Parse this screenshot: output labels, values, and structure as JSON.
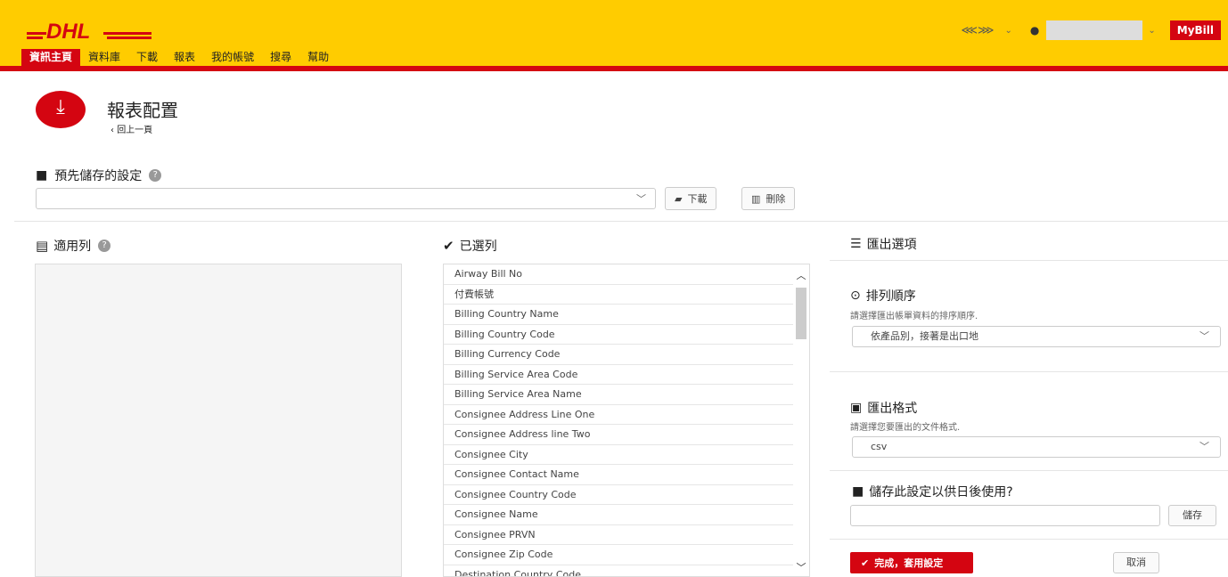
{
  "header": {
    "logo_text": "DHL",
    "mybill_label": "MyBill",
    "nav": [
      {
        "label": "資訊主頁",
        "active": true
      },
      {
        "label": "資料庫",
        "active": false
      },
      {
        "label": "下載",
        "active": false
      },
      {
        "label": "報表",
        "active": false
      },
      {
        "label": "我的帳號",
        "active": false
      },
      {
        "label": "搜尋",
        "active": false
      },
      {
        "label": "幫助",
        "active": false
      }
    ]
  },
  "page": {
    "title": "報表配置",
    "back_link": "回上一頁"
  },
  "saved_settings": {
    "label": "預先儲存的設定",
    "select_value": "",
    "download_label": "下載",
    "delete_label": "刪除"
  },
  "available_columns": {
    "heading": "適用列"
  },
  "selected_columns": {
    "heading": "已選列",
    "items": [
      "Airway Bill No",
      "付費帳號",
      "Billing Country Name",
      "Billing Country Code",
      "Billing Currency Code",
      "Billing Service Area Code",
      "Billing Service Area Name",
      "Consignee Address Line One",
      "Consignee Address line Two",
      "Consignee City",
      "Consignee Contact Name",
      "Consignee Country Code",
      "Consignee Name",
      "Consignee PRVN",
      "Consignee Zip Code",
      "Destination Country Code"
    ]
  },
  "export_options": {
    "heading": "匯出選項",
    "sort": {
      "title": "排列順序",
      "description": "請選擇匯出帳單資料的排序順序.",
      "value": "依產品別，接著是出口地"
    },
    "format": {
      "title": "匯出格式",
      "description": "請選擇您要匯出的文件格式.",
      "value": "csv"
    },
    "save": {
      "title": "儲存此設定以供日後使用?",
      "input_value": "",
      "button_label": "儲存"
    },
    "done_label": "完成，套用設定",
    "cancel_label": "取消"
  },
  "colors": {
    "brand_yellow": "#ffcc00",
    "brand_red": "#d40511"
  }
}
